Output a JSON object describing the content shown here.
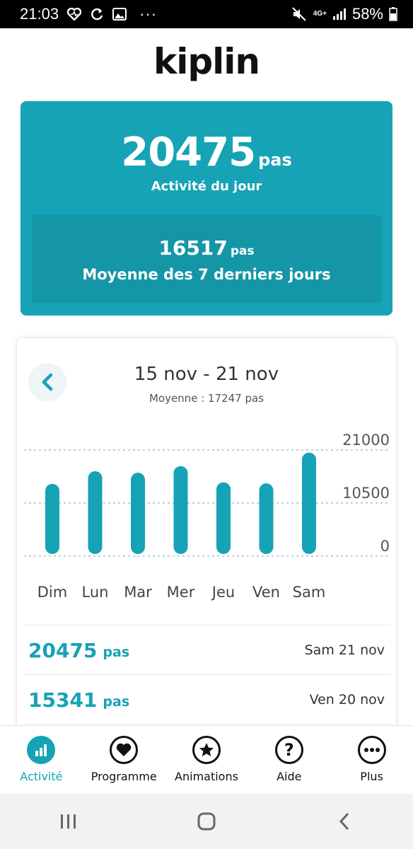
{
  "status_bar": {
    "time": "21:03",
    "network": "4G+",
    "battery": "58%",
    "more": "···"
  },
  "app": {
    "logo": "kiplin"
  },
  "today": {
    "steps": "20475",
    "unit": "pas",
    "label": "Activité du jour"
  },
  "average7": {
    "steps": "16517",
    "unit": "pas",
    "label": "Moyenne des 7 derniers jours"
  },
  "week": {
    "title": "15 nov - 21 nov",
    "subtitle": "Moyenne : 17247 pas"
  },
  "chart_data": {
    "type": "bar",
    "categories": [
      "Dim",
      "Lun",
      "Mar",
      "Mer",
      "Jeu",
      "Ven",
      "Sam"
    ],
    "values": [
      14300,
      16800,
      16500,
      17800,
      14600,
      14400,
      20475
    ],
    "ylim": [
      0,
      21000
    ],
    "yticks": [
      "21000",
      "10500",
      "0"
    ],
    "grid": true,
    "bar_color": "#15a3b5"
  },
  "entries": [
    {
      "value": "20475",
      "unit": "pas",
      "date": "Sam 21 nov"
    },
    {
      "value": "15341",
      "unit": "pas",
      "date": "Ven 20 nov"
    }
  ],
  "bottom_nav": [
    {
      "label": "Activité",
      "icon": "bar-chart-icon",
      "active": true
    },
    {
      "label": "Programme",
      "icon": "heart-icon",
      "active": false
    },
    {
      "label": "Animations",
      "icon": "star-icon",
      "active": false
    },
    {
      "label": "Aide",
      "icon": "question-icon",
      "active": false
    },
    {
      "label": "Plus",
      "icon": "more-icon",
      "active": false
    }
  ],
  "colors": {
    "accent": "#15a3b5",
    "accent_dark": "#1496a6"
  }
}
